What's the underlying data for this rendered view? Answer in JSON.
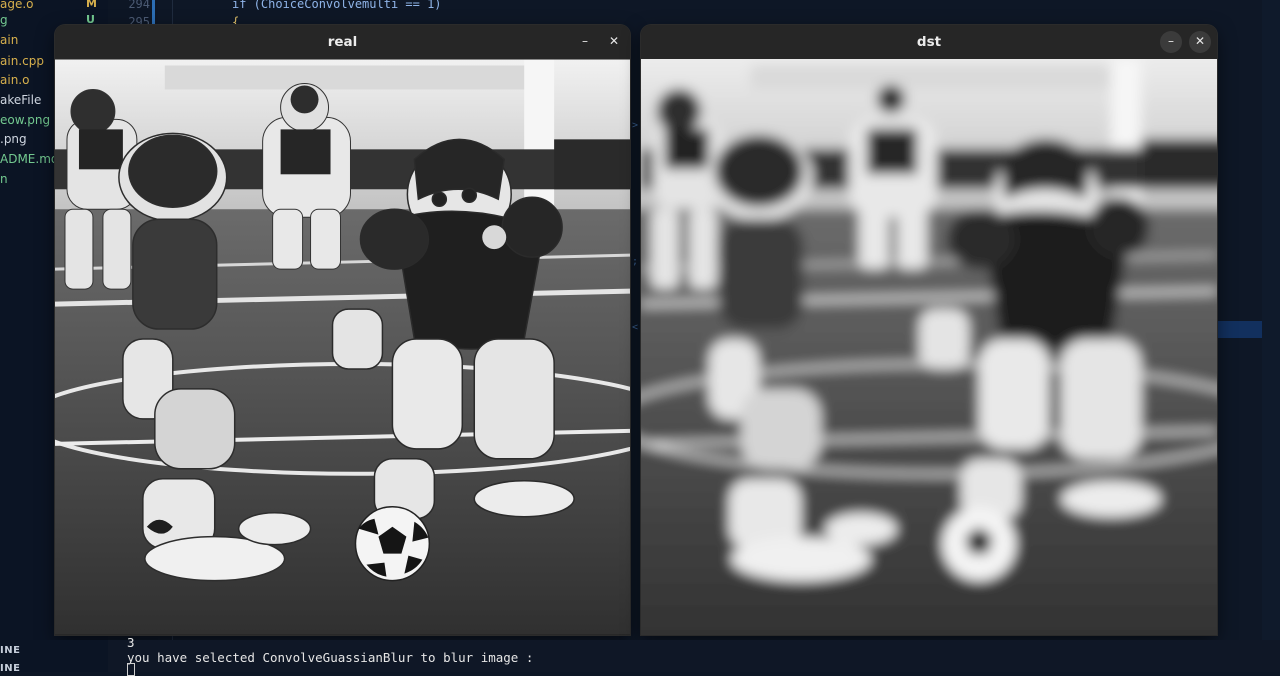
{
  "explorer": {
    "items": [
      {
        "name": "age.o",
        "badge": "M",
        "color": "#d7b04d",
        "badge_color": "#d7b04d"
      },
      {
        "name": "g",
        "badge": "U",
        "color": "#73c990",
        "badge_color": "#73c990"
      },
      {
        "name": "ain",
        "badge": "",
        "color": "#d7b04d",
        "badge_color": "#d7b04d"
      },
      {
        "name": "ain.cpp",
        "badge": "",
        "color": "#d7b04d",
        "badge_color": "#d7b04d"
      },
      {
        "name": "ain.o",
        "badge": "",
        "color": "#d7b04d",
        "badge_color": "#d7b04d"
      },
      {
        "name": "akeFile",
        "badge": "",
        "color": "#cfd6e0",
        "badge_color": "#cfd6e0"
      },
      {
        "name": "eow.png",
        "badge": "",
        "color": "#73c990",
        "badge_color": "#73c990"
      },
      {
        "name": ".png",
        "badge": "",
        "color": "#cfd6e0",
        "badge_color": "#cfd6e0"
      },
      {
        "name": "ADME.md",
        "badge": "",
        "color": "#73c990",
        "badge_color": "#73c990"
      },
      {
        "name": "n",
        "badge": "",
        "color": "#73c990",
        "badge_color": "#73c990"
      }
    ]
  },
  "editor": {
    "line_numbers": [
      "294",
      "295"
    ],
    "code_line_1": "if (ChoiceConvolvemulti == 1)",
    "code_line_2": "{"
  },
  "windows": {
    "real": {
      "title": "real",
      "minimize": "–",
      "close": "✕"
    },
    "dst": {
      "title": "dst",
      "minimize": "–",
      "close": "✕"
    }
  },
  "panel": {
    "headers": [
      "INE",
      "INE"
    ]
  },
  "terminal": {
    "lines": [
      "3",
      "you have selected ConvolveGuassianBlur to blur image :"
    ]
  },
  "colors": {
    "editor_bg": "#0e1726",
    "accent_selection": "#12305e",
    "titlebar": "#262626"
  }
}
